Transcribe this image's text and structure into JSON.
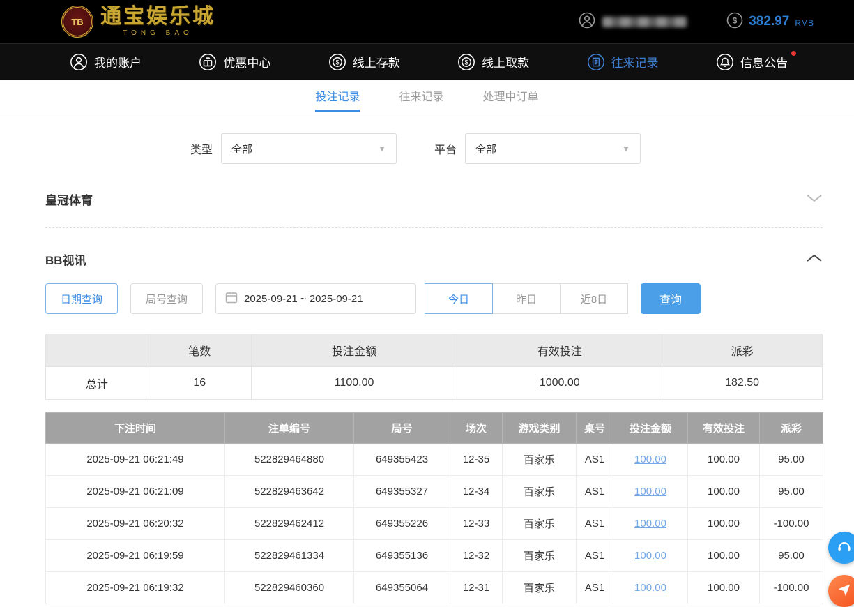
{
  "colors": {
    "accent": "#3a8ee6",
    "nav_active": "#3f7fd0",
    "link": "#74a8e6",
    "negative": "#e05252",
    "balance": "#2d7dd2",
    "search_button": "#4a9fe8"
  },
  "header": {
    "logo_badge": "TB",
    "logo_title": "通宝娱乐城",
    "logo_subtitle": "TONG BAO",
    "balance": "382.97",
    "currency": "RMB"
  },
  "nav": {
    "items": [
      {
        "label": "我的账户",
        "active": false
      },
      {
        "label": "优惠中心",
        "active": false
      },
      {
        "label": "线上存款",
        "active": false
      },
      {
        "label": "线上取款",
        "active": false
      },
      {
        "label": "往来记录",
        "active": true
      },
      {
        "label": "信息公告",
        "active": false,
        "has_badge": true
      }
    ]
  },
  "tabs": {
    "items": [
      {
        "label": "投注记录",
        "active": true
      },
      {
        "label": "往来记录",
        "active": false
      },
      {
        "label": "处理中订单",
        "active": false
      }
    ]
  },
  "filters": {
    "type_label": "类型",
    "type_value": "全部",
    "platform_label": "平台",
    "platform_value": "全部"
  },
  "sections": {
    "crown": "皇冠体育",
    "bb": "BB视讯"
  },
  "query": {
    "date_btn": "日期查询",
    "round_btn": "局号查询",
    "date_range": "2025-09-21 ~ 2025-09-21",
    "today": "今日",
    "yesterday": "昨日",
    "last8": "近8日",
    "search": "查询"
  },
  "summary": {
    "headers": [
      "笔数",
      "投注金额",
      "有效投注",
      "派彩"
    ],
    "total_label": "总计",
    "count": "16",
    "bet_amount": "1100.00",
    "valid_bet": "1000.00",
    "payout": "182.50"
  },
  "table": {
    "headers": [
      "下注时间",
      "注单编号",
      "局号",
      "场次",
      "游戏类别",
      "桌号",
      "投注金额",
      "有效投注",
      "派彩"
    ],
    "header_keys": [
      "bet_time",
      "order_no",
      "round_no",
      "session",
      "game_type",
      "table_no",
      "bet_amount",
      "valid_bet",
      "payout"
    ],
    "rows": [
      [
        "2025-09-21 06:21:49",
        "522829464880",
        "649355423",
        "12-35",
        "百家乐",
        "AS1",
        "100.00",
        "100.00",
        "95.00"
      ],
      [
        "2025-09-21 06:21:09",
        "522829463642",
        "649355327",
        "12-34",
        "百家乐",
        "AS1",
        "100.00",
        "100.00",
        "95.00"
      ],
      [
        "2025-09-21 06:20:32",
        "522829462412",
        "649355226",
        "12-33",
        "百家乐",
        "AS1",
        "100.00",
        "100.00",
        "-100.00"
      ],
      [
        "2025-09-21 06:19:59",
        "522829461334",
        "649355136",
        "12-32",
        "百家乐",
        "AS1",
        "100.00",
        "100.00",
        "95.00"
      ],
      [
        "2025-09-21 06:19:32",
        "522829460360",
        "649355064",
        "12-31",
        "百家乐",
        "AS1",
        "100.00",
        "100.00",
        "-100.00"
      ]
    ]
  }
}
